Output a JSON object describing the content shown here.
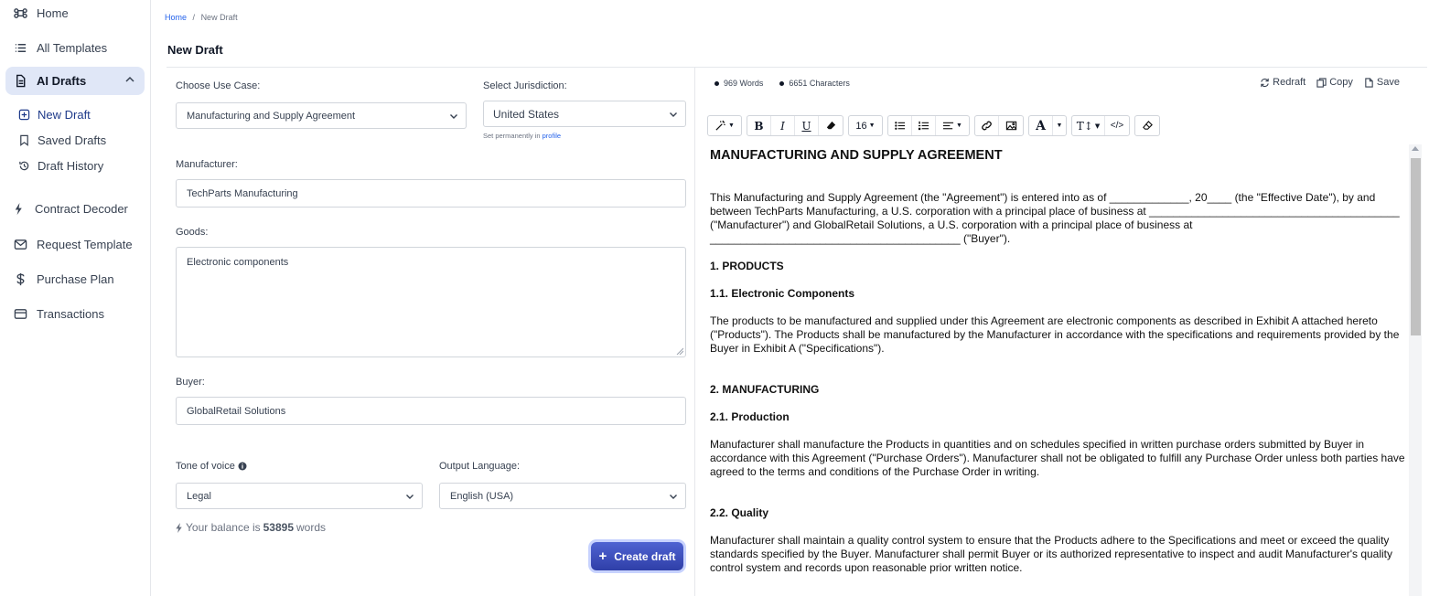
{
  "sidebar": {
    "items": [
      {
        "label": "Home",
        "icon": "command-icon"
      },
      {
        "label": "All Templates",
        "icon": "list-icon"
      },
      {
        "label": "AI Drafts",
        "icon": "document-icon"
      },
      {
        "label": "Contract Decoder",
        "icon": "bolt-icon"
      },
      {
        "label": "Request Template",
        "icon": "mail-icon"
      },
      {
        "label": "Purchase Plan",
        "icon": "dollar-icon"
      },
      {
        "label": "Transactions",
        "icon": "card-icon"
      }
    ],
    "sub_items": [
      {
        "label": "New Draft",
        "icon": "plus-square-icon"
      },
      {
        "label": "Saved Drafts",
        "icon": "bookmark-icon"
      },
      {
        "label": "Draft History",
        "icon": "history-icon"
      }
    ]
  },
  "breadcrumb": {
    "home": "Home",
    "separator": "/",
    "current": "New Draft"
  },
  "page_title": "New Draft",
  "form": {
    "use_case_label": "Choose Use Case:",
    "use_case_value": "Manufacturing and Supply Agreement",
    "jurisdiction_label": "Select Jurisdiction:",
    "jurisdiction_value": "United States",
    "jurisdiction_hint": "Set permanently in",
    "jurisdiction_hint_link": "profile",
    "manufacturer_label": "Manufacturer:",
    "manufacturer_value": "TechParts Manufacturing",
    "goods_label": "Goods:",
    "goods_value": "Electronic components",
    "buyer_label": "Buyer:",
    "buyer_value": "GlobalRetail Solutions",
    "tone_label": "Tone of voice",
    "tone_value": "Legal",
    "language_label": "Output Language:",
    "language_value": "English (USA)",
    "balance_prefix": "Your balance is",
    "balance_value": "53895",
    "balance_suffix": "words",
    "create_button": "Create draft"
  },
  "editor": {
    "words": "969 Words",
    "characters": "6651 Characters",
    "redraft": "Redraft",
    "copy": "Copy",
    "save": "Save",
    "font_size": "16",
    "accent_color": "#2f3fa8"
  },
  "document": {
    "title": "MANUFACTURING AND SUPPLY AGREEMENT",
    "intro": "This Manufacturing and Supply Agreement (the \"Agreement\") is entered into as of _____________, 20____ (the \"Effective Date\"), by and between TechParts Manufacturing, a U.S. corporation with a principal place of business at _________________________________________ (\"Manufacturer\") and GlobalRetail Solutions, a U.S. corporation with a principal place of business at _________________________________________ (\"Buyer\").",
    "s1": "1. PRODUCTS",
    "s1_1": "1.1. Electronic Components",
    "s1_1_text": "The products to be manufactured and supplied under this Agreement are electronic components as described in Exhibit A attached hereto (\"Products\"). The Products shall be manufactured by the Manufacturer in accordance with the specifications and requirements provided by the Buyer in Exhibit A (\"Specifications\").",
    "s2": "2. MANUFACTURING",
    "s2_1": "2.1. Production",
    "s2_1_text": "Manufacturer shall manufacture the Products in quantities and on schedules specified in written purchase orders submitted by Buyer in accordance with this Agreement (\"Purchase Orders\"). Manufacturer shall not be obligated to fulfill any Purchase Order unless both parties have agreed to the terms and conditions of the Purchase Order in writing.",
    "s2_2": "2.2. Quality",
    "s2_2_text": "Manufacturer shall maintain a quality control system to ensure that the Products adhere to the Specifications and meet or exceed the quality standards specified by the Buyer. Manufacturer shall permit Buyer or its authorized representative to inspect and audit Manufacturer's quality control system and records upon reasonable prior written notice."
  }
}
